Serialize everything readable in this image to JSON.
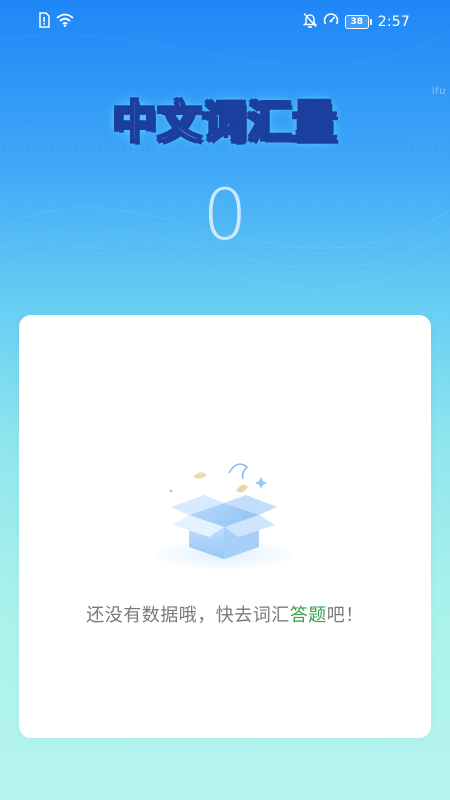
{
  "status_bar": {
    "time": "2:57",
    "battery_level": "38",
    "icons": [
      "sim-icon",
      "wifi-icon",
      "bell-off-icon",
      "speed-icon"
    ]
  },
  "header": {
    "title": "中文词汇量",
    "side_label": "ifu"
  },
  "main": {
    "count": "0"
  },
  "empty_state": {
    "text_prefix": "还没有数据哦，快去词汇",
    "link_label": "答题",
    "text_suffix": "吧！"
  },
  "colors": {
    "accent_green": "#3aa24a",
    "title_stroke": "#1b3f9e",
    "bg_top": "#1f86f7",
    "bg_bottom": "#b6f5ee"
  }
}
